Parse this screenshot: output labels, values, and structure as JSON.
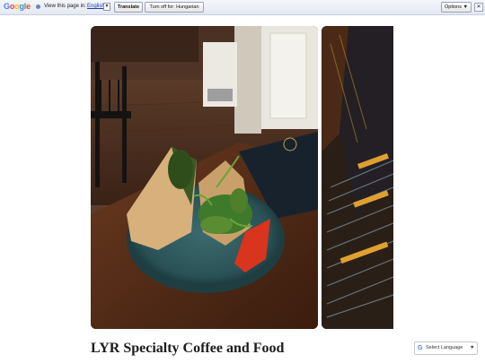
{
  "translate_bar": {
    "logo": [
      "G",
      "o",
      "o",
      "g",
      "l",
      "e"
    ],
    "info_icon": "info-icon",
    "prompt": "View this page in:",
    "language": "English",
    "dropdown_arrow": "▼",
    "translate_label": "Translate",
    "turn_off_label": "Turn off for: Hungarian",
    "options_label": "Options ▼",
    "close_label": "✕"
  },
  "post": {
    "title": "LYR Specialty Coffee and Food",
    "images": [
      "wrap-sandwich-photo",
      "menu-photo"
    ]
  },
  "language_widget": {
    "icon": "G",
    "label": "Select Language",
    "arrow": "▼"
  },
  "colors": {
    "bar_bg": "#e8ecf4",
    "heading": "#1b1b1b",
    "plate": "#2f5a5e"
  }
}
